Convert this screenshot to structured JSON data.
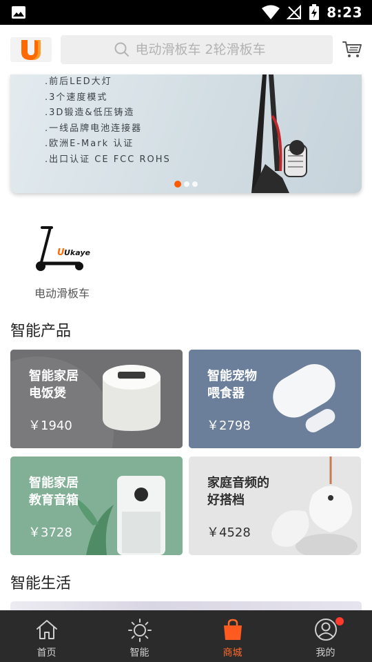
{
  "status_bar": {
    "time": "8:23"
  },
  "header": {
    "logo_text": "U",
    "search_placeholder": "电动滑板车 2轮滑板车"
  },
  "banner": {
    "features": [
      ".前后LED大灯",
      ".3个速度模式",
      ".3D锻造&低压铸造",
      ".一线品牌电池连接器",
      ".欧洲E-Mark 认证",
      ".出口认证 CE FCC ROHS"
    ],
    "page_count": 3,
    "active_page": 1
  },
  "categories": [
    {
      "label": "电动滑板车",
      "logo_text": "Ukaye"
    }
  ],
  "sections": {
    "smart_products": "智能产品",
    "smart_life": "智能生活"
  },
  "products": [
    {
      "title": "智能家居\n电饭煲",
      "price": "￥1940"
    },
    {
      "title": "智能宠物\n喂食器",
      "price": "￥2798"
    },
    {
      "title": "智能家居\n教育音箱",
      "price": "￥3728"
    },
    {
      "title": "家庭音频的\n好搭档",
      "price": "￥4528"
    }
  ],
  "tabbar": [
    {
      "label": "首页",
      "icon": "home-icon"
    },
    {
      "label": "智能",
      "icon": "sun-icon"
    },
    {
      "label": "商城",
      "icon": "shopping-bag-icon"
    },
    {
      "label": "我的",
      "icon": "user-icon"
    }
  ],
  "colors": {
    "accent": "#ff6a2a",
    "tabbar_bg": "#2b2b2b",
    "badge": "#ff3b30"
  }
}
